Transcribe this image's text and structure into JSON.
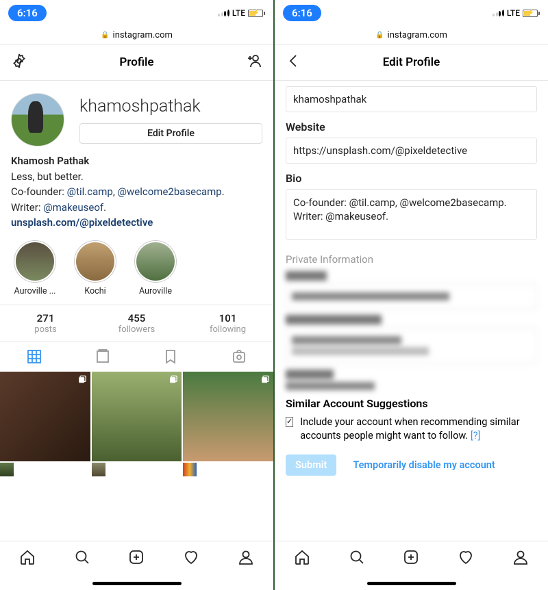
{
  "status": {
    "time": "6:16",
    "network": "LTE"
  },
  "url": "instagram.com",
  "left": {
    "header_title": "Profile",
    "username": "khamoshpathak",
    "edit_profile": "Edit Profile",
    "display_name": "Khamosh Pathak",
    "bio_line1": "Less, but better.",
    "bio_cofounder_prefix": "Co-founder: ",
    "bio_link1": "@til.camp",
    "bio_link2": "@welcome2basecamp",
    "bio_writer_prefix": "Writer: ",
    "bio_link3": "@makeuseof",
    "website": "unsplash.com/@pixeldetective",
    "highlights": [
      {
        "label": "Auroville ..."
      },
      {
        "label": "Kochi"
      },
      {
        "label": "Auroville"
      }
    ],
    "stats": {
      "posts": {
        "n": "271",
        "l": "posts"
      },
      "followers": {
        "n": "455",
        "l": "followers"
      },
      "following": {
        "n": "101",
        "l": "following"
      }
    }
  },
  "right": {
    "header_title": "Edit Profile",
    "username_value": "khamoshpathak",
    "website_label": "Website",
    "website_value": "https://unsplash.com/@pixeldetective",
    "bio_label": "Bio",
    "bio_value": "Co-founder: @til.camp, @welcome2basecamp.\nWriter: @makeuseof.",
    "private_info": "Private Information",
    "sas_title": "Similar Account Suggestions",
    "sas_text": "Include your account when recommending similar accounts people might want to follow.",
    "sas_help": "[?]",
    "submit": "Submit",
    "disable": "Temporarily disable my account"
  }
}
